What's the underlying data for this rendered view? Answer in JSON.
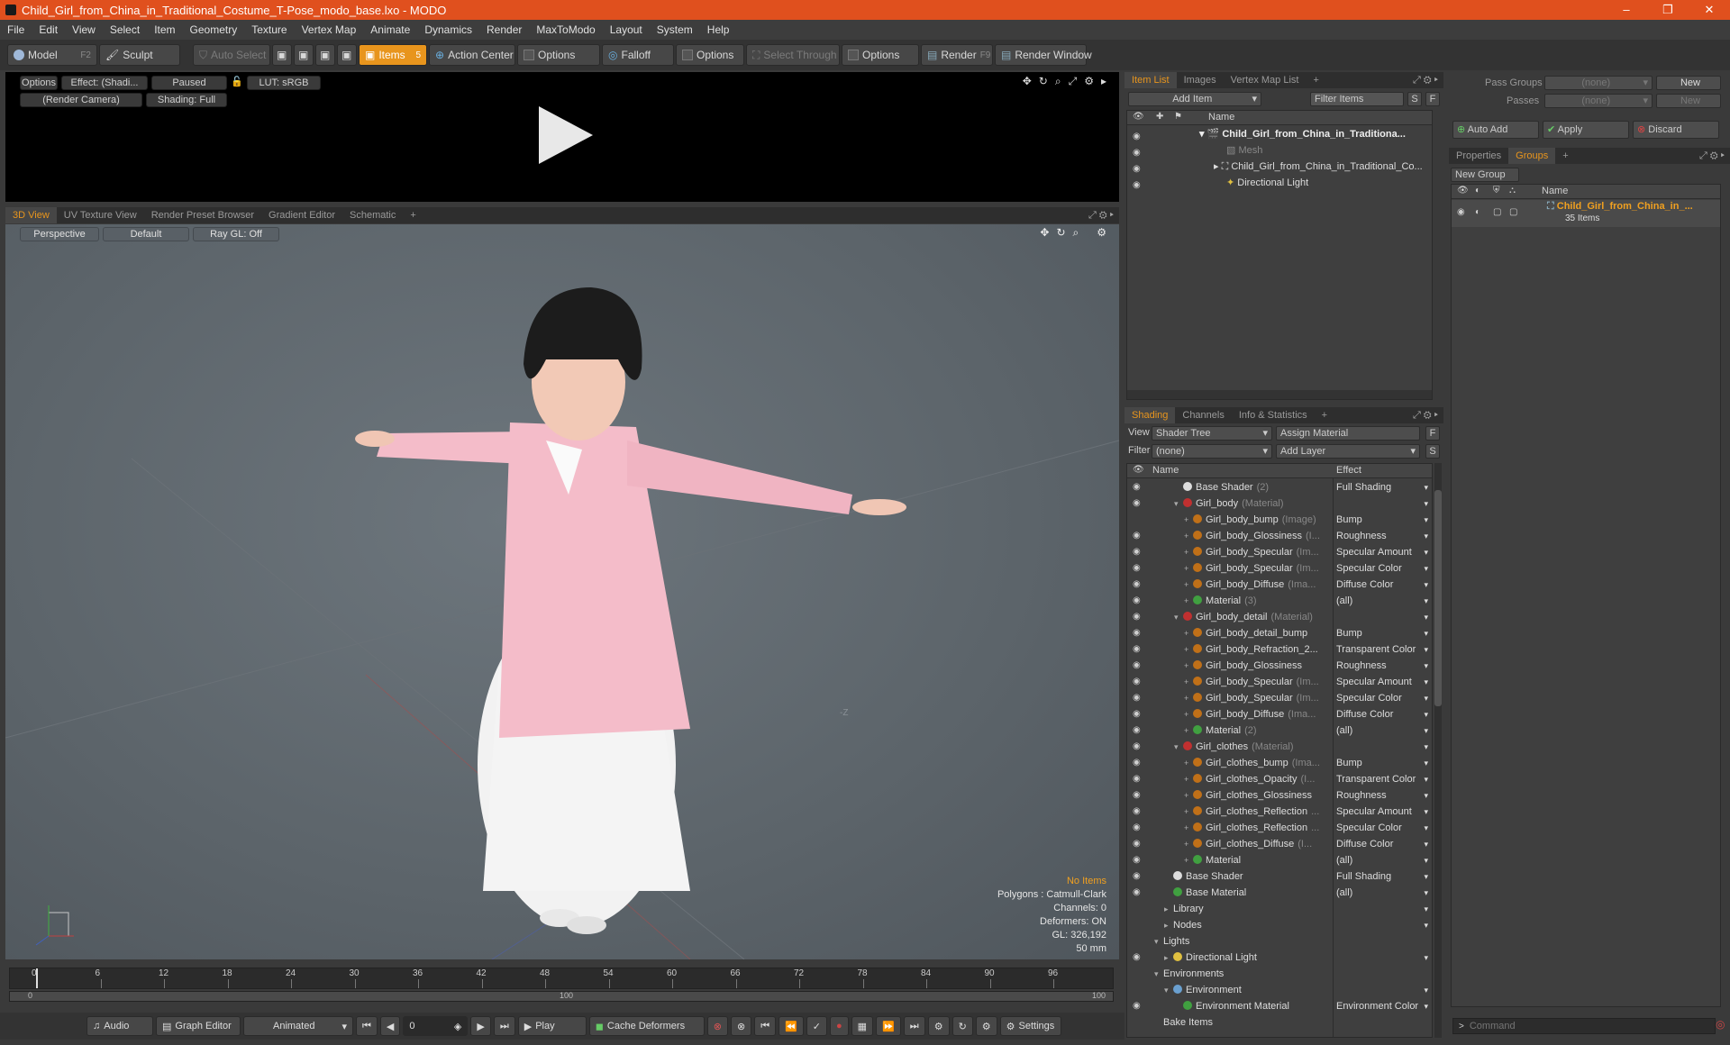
{
  "window": {
    "title": "Child_Girl_from_China_in_Traditional_Costume_T-Pose_modo_base.lxo - MODO",
    "controls": [
      "–",
      "❐",
      "✕"
    ]
  },
  "menu": [
    "File",
    "Edit",
    "View",
    "Select",
    "Item",
    "Geometry",
    "Texture",
    "Vertex Map",
    "Animate",
    "Dynamics",
    "Render",
    "MaxToModo",
    "Layout",
    "System",
    "Help"
  ],
  "toolbar": {
    "model": "Model",
    "model_key": "F2",
    "sculpt": "Sculpt",
    "auto_select": "Auto Select",
    "items": "Items",
    "items_key": "5",
    "action_center": "Action Center",
    "options1": "Options",
    "falloff": "Falloff",
    "options2": "Options",
    "select_through": "Select Through",
    "options3": "Options",
    "render": "Render",
    "render_key": "F9",
    "render_window": "Render Window"
  },
  "preview": {
    "options": "Options",
    "effect": "Effect: (Shadi...",
    "paused": "Paused",
    "lut": "LUT: sRGB",
    "camera": "(Render Camera)",
    "shading": "Shading: Full"
  },
  "view_tabs": [
    "3D View",
    "UV Texture View",
    "Render Preset Browser",
    "Gradient Editor",
    "Schematic",
    "+"
  ],
  "viewport": {
    "projection": "Perspective",
    "style": "Default",
    "raygl": "Ray GL: Off",
    "info": {
      "no_items": "No Items",
      "polygons": "Polygons : Catmull-Clark",
      "channels": "Channels: 0",
      "deformers": "Deformers: ON",
      "gl": "GL: 326,192",
      "focal": "50 mm"
    },
    "axis_label": "-Z"
  },
  "timeline": {
    "ticks": [
      "0",
      "6",
      "12",
      "18",
      "24",
      "30",
      "36",
      "42",
      "48",
      "54",
      "60",
      "66",
      "72",
      "78",
      "84",
      "90",
      "96"
    ],
    "range_start": "0",
    "range_mid": "100",
    "range_end": "100"
  },
  "bottombar": {
    "audio": "Audio",
    "graph_editor": "Graph Editor",
    "animated": "Animated",
    "frame": "0",
    "play": "Play",
    "cache_deformers": "Cache Deformers",
    "settings": "Settings"
  },
  "item_list": {
    "tabs": [
      "Item List",
      "Images",
      "Vertex Map List",
      "+"
    ],
    "add_item": "Add Item",
    "filter_items": "Filter Items",
    "s": "S",
    "f": "F",
    "col_name": "Name",
    "items": [
      {
        "label": "Child_Girl_from_China_in_Traditiona...",
        "indent": 0
      },
      {
        "label": "Mesh",
        "indent": 1
      },
      {
        "label": "Child_Girl_from_China_in_Traditional_Co...",
        "indent": 1
      },
      {
        "label": "Directional Light",
        "indent": 1
      }
    ]
  },
  "shading": {
    "tabs": [
      "Shading",
      "Channels",
      "Info & Statistics",
      "+"
    ],
    "view_label": "View",
    "view_value": "Shader Tree",
    "assign_material": "Assign Material",
    "f": "F",
    "filter_label": "Filter",
    "filter_value": "(none)",
    "add_layer": "Add Layer",
    "s": "S",
    "col_name": "Name",
    "col_effect": "Effect",
    "rows": [
      {
        "name": "Base Shader",
        "sub": "(2)",
        "effect": "Full Shading",
        "indent": 2,
        "icon": "#ddd",
        "eye": true
      },
      {
        "name": "Girl_body",
        "sub": "(Material)",
        "effect": "",
        "indent": 2,
        "icon": "#c03030",
        "eye": true,
        "expand": "▾"
      },
      {
        "name": "Girl_body_bump",
        "sub": "(Image)",
        "effect": "Bump",
        "indent": 3,
        "icon": "#c07018",
        "eye": false
      },
      {
        "name": "Girl_body_Glossiness",
        "sub": "(I...",
        "effect": "Roughness",
        "indent": 3,
        "icon": "#c07018",
        "eye": true
      },
      {
        "name": "Girl_body_Specular",
        "sub": "(Im...",
        "effect": "Specular Amount",
        "indent": 3,
        "icon": "#c07018",
        "eye": true
      },
      {
        "name": "Girl_body_Specular",
        "sub": "(Im...",
        "effect": "Specular Color",
        "indent": 3,
        "icon": "#c07018",
        "eye": true
      },
      {
        "name": "Girl_body_Diffuse",
        "sub": "(Ima...",
        "effect": "Diffuse Color",
        "indent": 3,
        "icon": "#c07018",
        "eye": true
      },
      {
        "name": "Material",
        "sub": "(3)",
        "effect": "(all)",
        "indent": 3,
        "icon": "#40a040",
        "eye": true
      },
      {
        "name": "Girl_body_detail",
        "sub": "(Material)",
        "effect": "",
        "indent": 2,
        "icon": "#c03030",
        "eye": true,
        "expand": "▾"
      },
      {
        "name": "Girl_body_detail_bump",
        "sub": "",
        "effect": "Bump",
        "indent": 3,
        "icon": "#c07018",
        "eye": true
      },
      {
        "name": "Girl_body_Refraction_2...",
        "sub": "",
        "effect": "Transparent Color",
        "indent": 3,
        "icon": "#c07018",
        "eye": true
      },
      {
        "name": "Girl_body_Glossiness",
        "sub": "",
        "effect": "Roughness",
        "indent": 3,
        "icon": "#c07018",
        "eye": true
      },
      {
        "name": "Girl_body_Specular",
        "sub": "(Im...",
        "effect": "Specular Amount",
        "indent": 3,
        "icon": "#c07018",
        "eye": true
      },
      {
        "name": "Girl_body_Specular",
        "sub": "(Im...",
        "effect": "Specular Color",
        "indent": 3,
        "icon": "#c07018",
        "eye": true
      },
      {
        "name": "Girl_body_Diffuse",
        "sub": "(Ima...",
        "effect": "Diffuse Color",
        "indent": 3,
        "icon": "#c07018",
        "eye": true
      },
      {
        "name": "Material",
        "sub": "(2)",
        "effect": "(all)",
        "indent": 3,
        "icon": "#40a040",
        "eye": true
      },
      {
        "name": "Girl_clothes",
        "sub": "(Material)",
        "effect": "",
        "indent": 2,
        "icon": "#c03030",
        "eye": true,
        "expand": "▾"
      },
      {
        "name": "Girl_clothes_bump",
        "sub": "(Ima...",
        "effect": "Bump",
        "indent": 3,
        "icon": "#c07018",
        "eye": true
      },
      {
        "name": "Girl_clothes_Opacity",
        "sub": "(I...",
        "effect": "Transparent Color",
        "indent": 3,
        "icon": "#c07018",
        "eye": true
      },
      {
        "name": "Girl_clothes_Glossiness",
        "sub": "",
        "effect": "Roughness",
        "indent": 3,
        "icon": "#c07018",
        "eye": true
      },
      {
        "name": "Girl_clothes_Reflection",
        "sub": "...",
        "effect": "Specular Amount",
        "indent": 3,
        "icon": "#c07018",
        "eye": true
      },
      {
        "name": "Girl_clothes_Reflection",
        "sub": "...",
        "effect": "Specular Color",
        "indent": 3,
        "icon": "#c07018",
        "eye": true
      },
      {
        "name": "Girl_clothes_Diffuse",
        "sub": "(I...",
        "effect": "Diffuse Color",
        "indent": 3,
        "icon": "#c07018",
        "eye": true
      },
      {
        "name": "Material",
        "sub": "",
        "effect": "(all)",
        "indent": 3,
        "icon": "#40a040",
        "eye": true
      },
      {
        "name": "Base Shader",
        "sub": "",
        "effect": "Full Shading",
        "indent": 1,
        "icon": "#ddd",
        "eye": true
      },
      {
        "name": "Base Material",
        "sub": "",
        "effect": "(all)",
        "indent": 1,
        "icon": "#40a040",
        "eye": true
      },
      {
        "name": "Library",
        "sub": "",
        "effect": "",
        "indent": 1,
        "icon": "",
        "eye": false,
        "expand": "▸"
      },
      {
        "name": "Nodes",
        "sub": "",
        "effect": "",
        "indent": 1,
        "icon": "",
        "eye": false,
        "expand": "▸"
      },
      {
        "name": "Lights",
        "sub": "",
        "effect": "",
        "indent": 0,
        "icon": "",
        "eye": false,
        "expand": "▾"
      },
      {
        "name": "Directional Light",
        "sub": "",
        "effect": "",
        "indent": 1,
        "icon": "#e0c040",
        "eye": true,
        "expand": "▸"
      },
      {
        "name": "Environments",
        "sub": "",
        "effect": "",
        "indent": 0,
        "icon": "",
        "eye": false,
        "expand": "▾"
      },
      {
        "name": "Environment",
        "sub": "",
        "effect": "",
        "indent": 1,
        "icon": "#6aa0d0",
        "eye": false,
        "expand": "▾"
      },
      {
        "name": "Environment Material",
        "sub": "",
        "effect": "Environment Color",
        "indent": 2,
        "icon": "#40a040",
        "eye": true
      },
      {
        "name": "Bake Items",
        "sub": "",
        "effect": "",
        "indent": 0,
        "icon": "",
        "eye": false
      }
    ]
  },
  "right_panel": {
    "pass_groups_label": "Pass Groups",
    "pass_groups_value": "(none)",
    "new1": "New",
    "passes_label": "Passes",
    "passes_value": "(none)",
    "new2": "New",
    "auto_add": "Auto Add",
    "apply": "Apply",
    "discard": "Discard",
    "tabs": [
      "Properties",
      "Groups",
      "+"
    ],
    "new_group": "New Group",
    "col_name": "Name",
    "group_name": "Child_Girl_from_China_in_...",
    "group_count": "35 Items",
    "command_placeholder": "Command"
  }
}
